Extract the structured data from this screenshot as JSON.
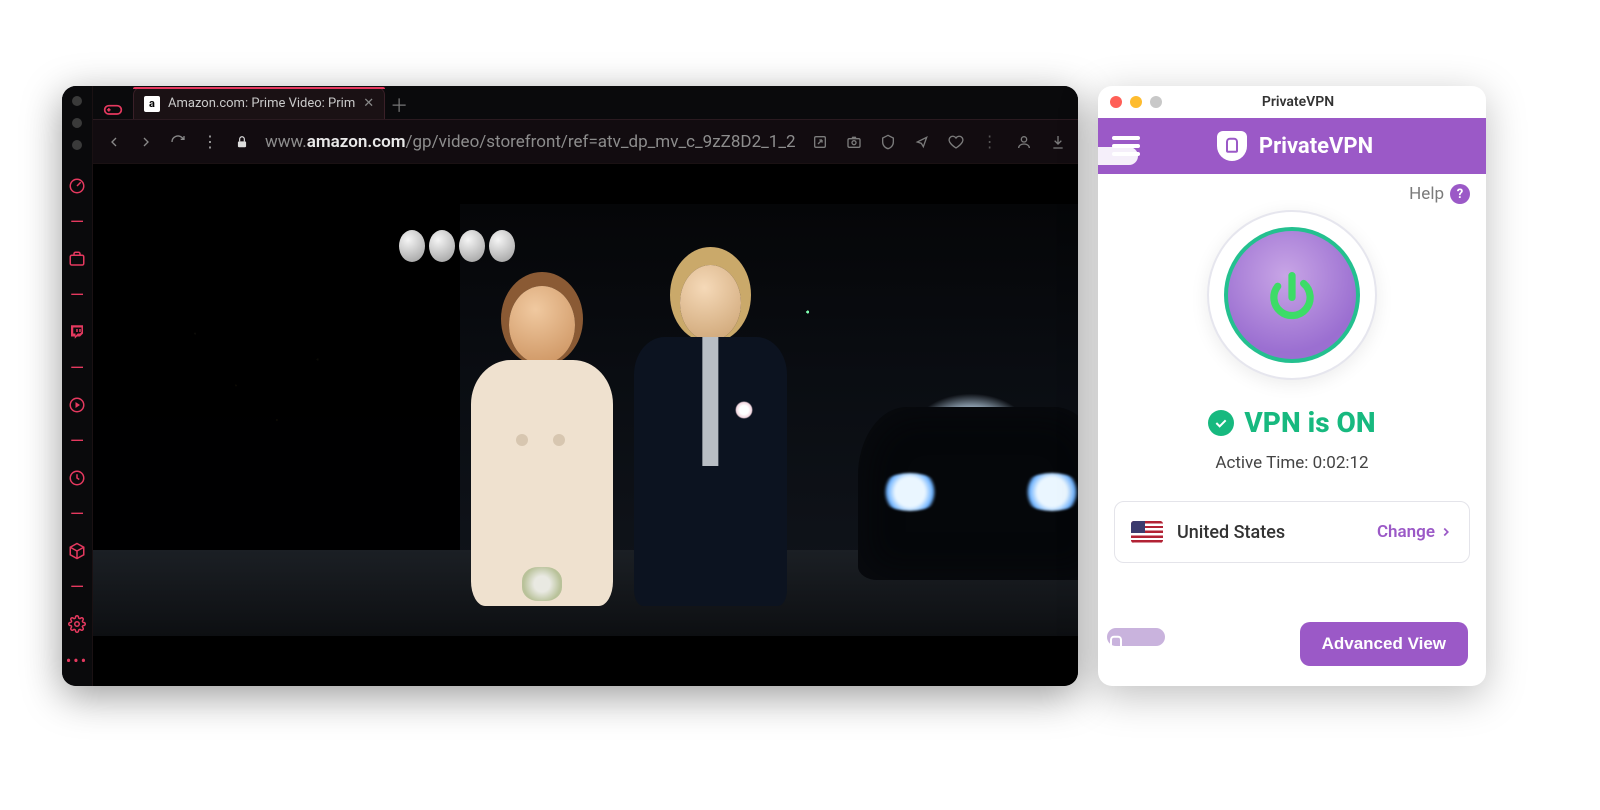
{
  "browser": {
    "tab": {
      "title": "Amazon.com: Prime Video: Prim",
      "favicon_letter": "a"
    },
    "url_prefix": "www.",
    "url_host": "amazon.com",
    "url_path": "/gp/video/storefront/ref=atv_dp_mv_c_9zZ8D2_1_2",
    "sidebar_icons": [
      "gamepad",
      "gauge",
      "briefcase",
      "twitch",
      "play-circle",
      "clock",
      "cube",
      "gear",
      "more"
    ]
  },
  "vpn": {
    "window_title": "PrivateVPN",
    "brand": "PrivateVPN",
    "help_label": "Help",
    "status": "VPN is ON",
    "active_time_label": "Active Time: ",
    "active_time_value": "0:02:12",
    "location_name": "United States",
    "change_label": "Change",
    "advanced_label": "Advanced View"
  }
}
